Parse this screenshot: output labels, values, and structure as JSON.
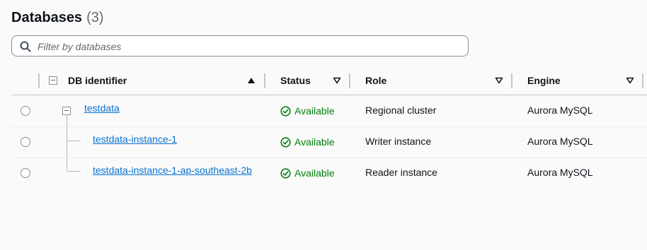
{
  "header": {
    "title": "Databases",
    "count": "(3)"
  },
  "search": {
    "placeholder": "Filter by databases",
    "value": ""
  },
  "columns": {
    "db_identifier": "DB identifier",
    "status": "Status",
    "role": "Role",
    "engine": "Engine"
  },
  "rows": [
    {
      "identifier": "testdata",
      "status": "Available",
      "role": "Regional cluster",
      "engine": "Aurora MySQL"
    },
    {
      "identifier": "testdata-instance-1",
      "status": "Available",
      "role": "Writer instance",
      "engine": "Aurora MySQL"
    },
    {
      "identifier": "testdata-instance-1-ap-southeast-2b",
      "status": "Available",
      "role": "Reader instance",
      "engine": "Aurora MySQL"
    }
  ],
  "colors": {
    "link": "#0972d3",
    "status_success": "#037f0c",
    "border": "#c6c6cd"
  },
  "icons": {
    "search": "search-icon",
    "status": "status-success-icon",
    "sort_asc": "sort-ascending-icon",
    "sort": "sort-caret-icon",
    "expand": "collapse-icon"
  }
}
